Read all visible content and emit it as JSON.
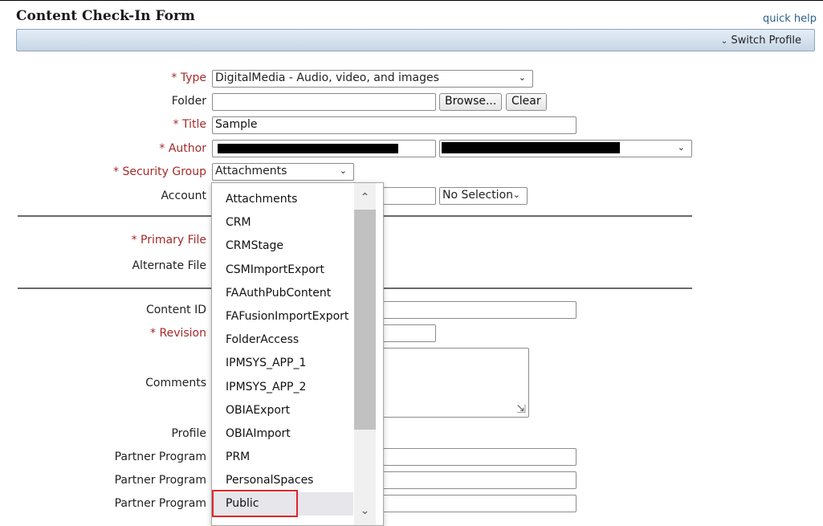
{
  "form": {
    "title": "Content Check-In Form",
    "quick_help": "quick help",
    "switch_profile": "Switch Profile",
    "required_mark": "* "
  },
  "fields": {
    "type": {
      "label": "Type",
      "value": "DigitalMedia - Audio, video, and images"
    },
    "folder": {
      "label": "Folder",
      "value": "",
      "browse": "Browse...",
      "clear": "Clear"
    },
    "title": {
      "label": "Title",
      "value": "Sample"
    },
    "author": {
      "label": "Author"
    },
    "security_group": {
      "label": "Security Group",
      "value": "Attachments"
    },
    "account": {
      "label": "Account",
      "selection": "No Selection"
    },
    "primary_file": {
      "label": "Primary File"
    },
    "alternate_file": {
      "label": "Alternate File"
    },
    "content_id": {
      "label": "Content ID"
    },
    "revision": {
      "label": "Revision"
    },
    "comments": {
      "label": "Comments"
    },
    "profile": {
      "label": "Profile"
    },
    "partner_program_1": {
      "label": "Partner Program"
    },
    "partner_program_2": {
      "label": "Partner Program"
    },
    "partner_program_3": {
      "label": "Partner Program"
    }
  },
  "security_group_options": [
    "Attachments",
    "CRM",
    "CRMStage",
    "CSMImportExport",
    "FAAuthPubContent",
    "FAFusionImportExport",
    "FolderAccess",
    "IPMSYS_APP_1",
    "IPMSYS_APP_2",
    "OBIAExport",
    "OBIAImport",
    "PRM",
    "PersonalSpaces",
    "Public"
  ],
  "selected_option": "Public",
  "colors": {
    "required_label": "#a52a2a",
    "highlight": "#e0252b",
    "link": "#2c5f8e"
  }
}
